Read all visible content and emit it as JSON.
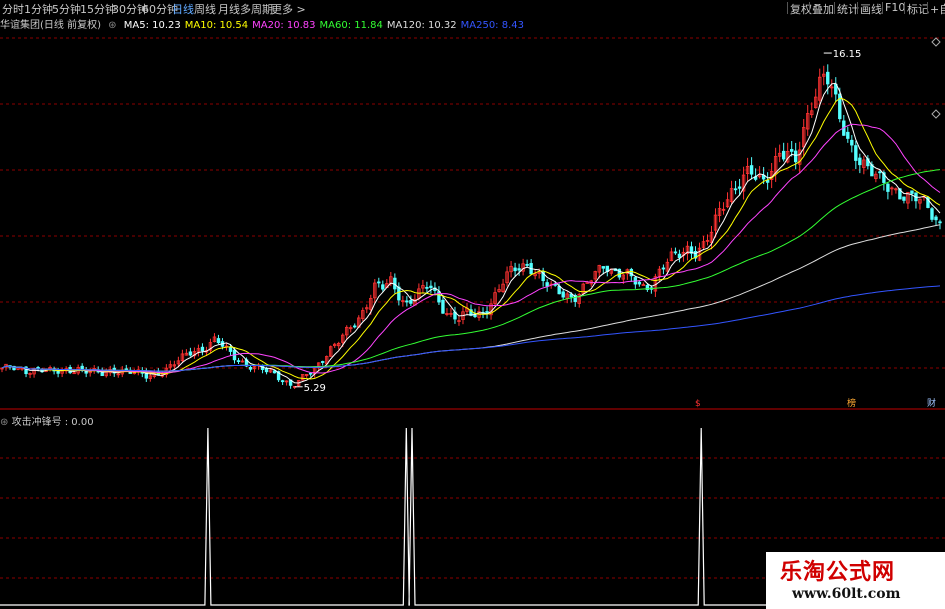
{
  "toolbar": {
    "tabs": [
      "分时",
      "1分钟",
      "5分钟",
      "15分钟",
      "30分钟",
      "60分钟",
      "日线",
      "周线",
      "月线",
      "多周期",
      "更多 >"
    ],
    "active_tab": "日线",
    "right_buttons": [
      "复权",
      "叠加",
      "统计",
      "画线",
      "F10",
      "标记",
      "+自"
    ]
  },
  "main_legend": {
    "title": "华谊集团(日线 前复权)",
    "items": [
      {
        "text": "MA5: 10.23",
        "color": "#ffffff"
      },
      {
        "text": "MA10: 10.54",
        "color": "#ffff00"
      },
      {
        "text": "MA20: 10.83",
        "color": "#ff44ff"
      },
      {
        "text": "MA60: 11.84",
        "color": "#33ff33"
      },
      {
        "text": "MA120: 10.32",
        "color": "#dddddd"
      },
      {
        "text": "MA250: 8.43",
        "color": "#3355ff"
      }
    ]
  },
  "sub_legend": {
    "text": "攻击冲锋号 : 0.00"
  },
  "markers": [
    "$",
    "榜",
    "财"
  ],
  "watermark": {
    "title": "乐淘公式网",
    "url": "www.60lt.com"
  },
  "colors": {
    "up": "#ff3232",
    "down": "#54ffff",
    "grid": "#8b0000",
    "signal": "#ffffff"
  },
  "chart_data": [
    {
      "type": "candlestick",
      "title": "华谊集团(日线 前复权)",
      "ylim": [
        4.6,
        16.9
      ],
      "annotations": [
        {
          "label": "16.15",
          "value": 16.15,
          "kind": "high"
        },
        {
          "label": "5.29",
          "value": 5.29,
          "kind": "low"
        }
      ],
      "close_trend": [
        5.9,
        5.9,
        5.85,
        5.8,
        5.85,
        5.9,
        5.8,
        5.75,
        5.8,
        5.85,
        5.9,
        5.8,
        5.75,
        5.7,
        5.8,
        5.85,
        5.8,
        5.75,
        5.7,
        5.65,
        5.7,
        5.8,
        5.9,
        6.1,
        6.3,
        6.5,
        6.5,
        6.6,
        6.8,
        6.6,
        6.4,
        6.2,
        6.0,
        5.9,
        5.85,
        5.8,
        5.7,
        5.5,
        5.3,
        5.45,
        5.7,
        5.9,
        6.2,
        6.5,
        6.7,
        7.0,
        7.3,
        7.6,
        8.1,
        8.6,
        8.5,
        8.7,
        8.3,
        8.0,
        8.2,
        8.4,
        8.6,
        8.2,
        7.8,
        7.6,
        7.5,
        7.7,
        7.6,
        7.7,
        8.0,
        8.4,
        8.8,
        9.1,
        9.2,
        9.3,
        9.0,
        8.7,
        8.5,
        8.4,
        8.3,
        8.2,
        8.4,
        8.7,
        9.0,
        9.3,
        9.1,
        9.0,
        8.9,
        8.7,
        8.5,
        8.6,
        9.0,
        9.3,
        9.5,
        9.6,
        9.8,
        9.7,
        9.9,
        10.3,
        10.9,
        11.4,
        11.8,
        12.1,
        12.3,
        12.0,
        11.9,
        12.5,
        13.0,
        12.9,
        12.5,
        13.4,
        14.4,
        15.2,
        15.6,
        14.8,
        13.8,
        13.2,
        12.9,
        12.6,
        12.3,
        12.0,
        11.8,
        11.7,
        11.6,
        11.5,
        11.4,
        11.2,
        10.9,
        10.6
      ]
    },
    {
      "type": "line",
      "title": "攻击冲锋号",
      "ylim": [
        0,
        1
      ],
      "signals": [
        {
          "x": 0.22,
          "y": 1
        },
        {
          "x": 0.43,
          "y": 1
        },
        {
          "x": 0.436,
          "y": 1
        },
        {
          "x": 0.742,
          "y": 1
        }
      ]
    }
  ]
}
